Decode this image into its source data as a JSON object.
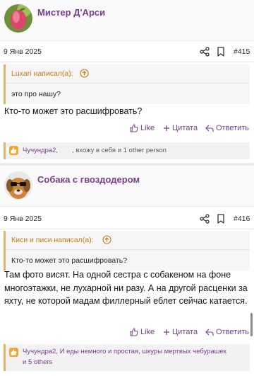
{
  "posts": [
    {
      "username": "Мистер Д'Арси",
      "date": "9 Янв 2025",
      "number": "#415",
      "quote": {
        "author": "Luxari написал(а):",
        "text": "это про нашу?"
      },
      "message": "Кто-то может это расшифровать?",
      "actions": {
        "like": "Like",
        "quote": "Цитата",
        "reply": "Ответить"
      },
      "reactions": {
        "names": "Чучундра2,",
        "rest": ", вхожу в себя и 1 other person"
      }
    },
    {
      "username": "Собака с гвоздодером",
      "date": "9 Янв 2025",
      "number": "#416",
      "quote": {
        "author": "Киси и писи написал(а):",
        "text": "Кто-то может это расшифровать?"
      },
      "message": "Там фото висят. На одной сестра с собакеном на фоне многоэтажки, не лухарной ни разу. А на другой расценки за яхту, не которой мадам филлерный еблет сейчас катается.",
      "actions": {
        "like": "Like",
        "quote": "Цитата",
        "reply": "Ответить"
      },
      "reactions": {
        "line1": "Чучундра2, И еды немного и простая, шкуры мертвых чебурашек",
        "line2": "и 5 others"
      }
    }
  ],
  "colors": {
    "accent": "#7a3b8f",
    "quote_border": "#e9b26a",
    "quote_author": "#c97a16"
  },
  "icons": [
    "share-icon",
    "bookmark-icon",
    "arrow-up-icon",
    "thumbs-up-icon",
    "plus-icon",
    "reply-icon"
  ]
}
